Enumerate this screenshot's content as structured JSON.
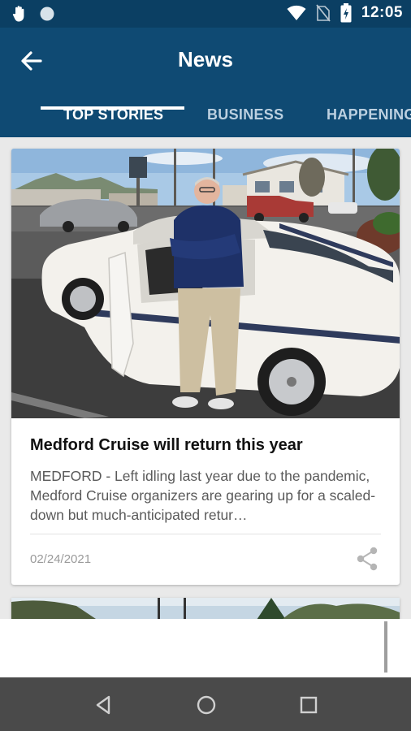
{
  "status_bar": {
    "time": "12:05",
    "icons": [
      "hand-gesture-icon",
      "circle-icon",
      "wifi-icon",
      "no-sim-icon",
      "battery-charging-icon"
    ]
  },
  "app_bar": {
    "title": "News",
    "back_icon": "arrow-left-icon"
  },
  "tabs": [
    {
      "label": "TOP STORIES",
      "active": true
    },
    {
      "label": "BUSINESS",
      "active": false
    },
    {
      "label": "HAPPENINGS",
      "active": false
    }
  ],
  "articles": [
    {
      "headline": "Medford Cruise will return this year",
      "summary": "MEDFORD - Left idling last year due to the pandemic, Medford Cruise organizers are gearing up for a scaled-down but much-anticipated retur…",
      "date": "02/24/2021",
      "share_icon": "share-icon"
    }
  ],
  "nav_bar": {
    "buttons": [
      "back-triangle-icon",
      "home-circle-icon",
      "recents-square-icon"
    ]
  },
  "colors": {
    "status_bar": "#0b3f63",
    "app_bar": "#0f4a73",
    "tab_active": "#ffffff",
    "tab_inactive": "#bcd0e0",
    "nav_bar": "#4a4a4a"
  }
}
